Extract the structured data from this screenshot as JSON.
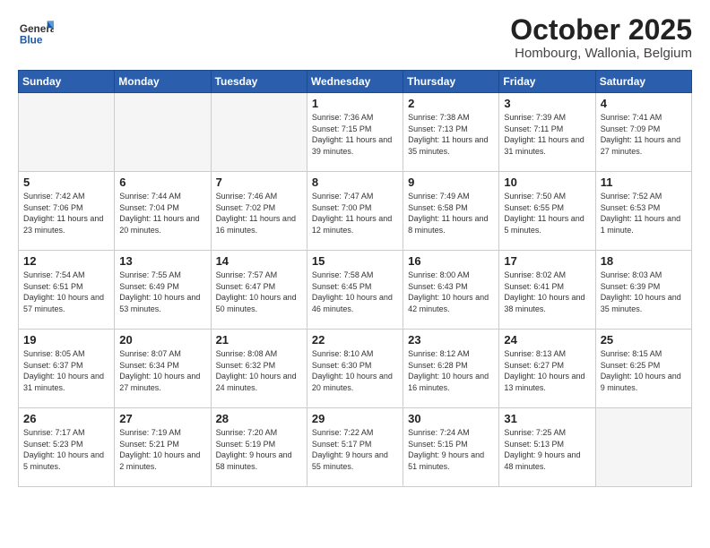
{
  "header": {
    "logo": {
      "general": "General",
      "blue": "Blue"
    },
    "title": "October 2025",
    "subtitle": "Hombourg, Wallonia, Belgium"
  },
  "weekdays": [
    "Sunday",
    "Monday",
    "Tuesday",
    "Wednesday",
    "Thursday",
    "Friday",
    "Saturday"
  ],
  "weeks": [
    [
      null,
      null,
      null,
      {
        "day": 1,
        "sunrise": "7:36 AM",
        "sunset": "7:15 PM",
        "daylight": "11 hours and 39 minutes."
      },
      {
        "day": 2,
        "sunrise": "7:38 AM",
        "sunset": "7:13 PM",
        "daylight": "11 hours and 35 minutes."
      },
      {
        "day": 3,
        "sunrise": "7:39 AM",
        "sunset": "7:11 PM",
        "daylight": "11 hours and 31 minutes."
      },
      {
        "day": 4,
        "sunrise": "7:41 AM",
        "sunset": "7:09 PM",
        "daylight": "11 hours and 27 minutes."
      }
    ],
    [
      {
        "day": 5,
        "sunrise": "7:42 AM",
        "sunset": "7:06 PM",
        "daylight": "11 hours and 23 minutes."
      },
      {
        "day": 6,
        "sunrise": "7:44 AM",
        "sunset": "7:04 PM",
        "daylight": "11 hours and 20 minutes."
      },
      {
        "day": 7,
        "sunrise": "7:46 AM",
        "sunset": "7:02 PM",
        "daylight": "11 hours and 16 minutes."
      },
      {
        "day": 8,
        "sunrise": "7:47 AM",
        "sunset": "7:00 PM",
        "daylight": "11 hours and 12 minutes."
      },
      {
        "day": 9,
        "sunrise": "7:49 AM",
        "sunset": "6:58 PM",
        "daylight": "11 hours and 8 minutes."
      },
      {
        "day": 10,
        "sunrise": "7:50 AM",
        "sunset": "6:55 PM",
        "daylight": "11 hours and 5 minutes."
      },
      {
        "day": 11,
        "sunrise": "7:52 AM",
        "sunset": "6:53 PM",
        "daylight": "11 hours and 1 minute."
      }
    ],
    [
      {
        "day": 12,
        "sunrise": "7:54 AM",
        "sunset": "6:51 PM",
        "daylight": "10 hours and 57 minutes."
      },
      {
        "day": 13,
        "sunrise": "7:55 AM",
        "sunset": "6:49 PM",
        "daylight": "10 hours and 53 minutes."
      },
      {
        "day": 14,
        "sunrise": "7:57 AM",
        "sunset": "6:47 PM",
        "daylight": "10 hours and 50 minutes."
      },
      {
        "day": 15,
        "sunrise": "7:58 AM",
        "sunset": "6:45 PM",
        "daylight": "10 hours and 46 minutes."
      },
      {
        "day": 16,
        "sunrise": "8:00 AM",
        "sunset": "6:43 PM",
        "daylight": "10 hours and 42 minutes."
      },
      {
        "day": 17,
        "sunrise": "8:02 AM",
        "sunset": "6:41 PM",
        "daylight": "10 hours and 38 minutes."
      },
      {
        "day": 18,
        "sunrise": "8:03 AM",
        "sunset": "6:39 PM",
        "daylight": "10 hours and 35 minutes."
      }
    ],
    [
      {
        "day": 19,
        "sunrise": "8:05 AM",
        "sunset": "6:37 PM",
        "daylight": "10 hours and 31 minutes."
      },
      {
        "day": 20,
        "sunrise": "8:07 AM",
        "sunset": "6:34 PM",
        "daylight": "10 hours and 27 minutes."
      },
      {
        "day": 21,
        "sunrise": "8:08 AM",
        "sunset": "6:32 PM",
        "daylight": "10 hours and 24 minutes."
      },
      {
        "day": 22,
        "sunrise": "8:10 AM",
        "sunset": "6:30 PM",
        "daylight": "10 hours and 20 minutes."
      },
      {
        "day": 23,
        "sunrise": "8:12 AM",
        "sunset": "6:28 PM",
        "daylight": "10 hours and 16 minutes."
      },
      {
        "day": 24,
        "sunrise": "8:13 AM",
        "sunset": "6:27 PM",
        "daylight": "10 hours and 13 minutes."
      },
      {
        "day": 25,
        "sunrise": "8:15 AM",
        "sunset": "6:25 PM",
        "daylight": "10 hours and 9 minutes."
      }
    ],
    [
      {
        "day": 26,
        "sunrise": "7:17 AM",
        "sunset": "5:23 PM",
        "daylight": "10 hours and 5 minutes."
      },
      {
        "day": 27,
        "sunrise": "7:19 AM",
        "sunset": "5:21 PM",
        "daylight": "10 hours and 2 minutes."
      },
      {
        "day": 28,
        "sunrise": "7:20 AM",
        "sunset": "5:19 PM",
        "daylight": "9 hours and 58 minutes."
      },
      {
        "day": 29,
        "sunrise": "7:22 AM",
        "sunset": "5:17 PM",
        "daylight": "9 hours and 55 minutes."
      },
      {
        "day": 30,
        "sunrise": "7:24 AM",
        "sunset": "5:15 PM",
        "daylight": "9 hours and 51 minutes."
      },
      {
        "day": 31,
        "sunrise": "7:25 AM",
        "sunset": "5:13 PM",
        "daylight": "9 hours and 48 minutes."
      },
      null
    ]
  ]
}
